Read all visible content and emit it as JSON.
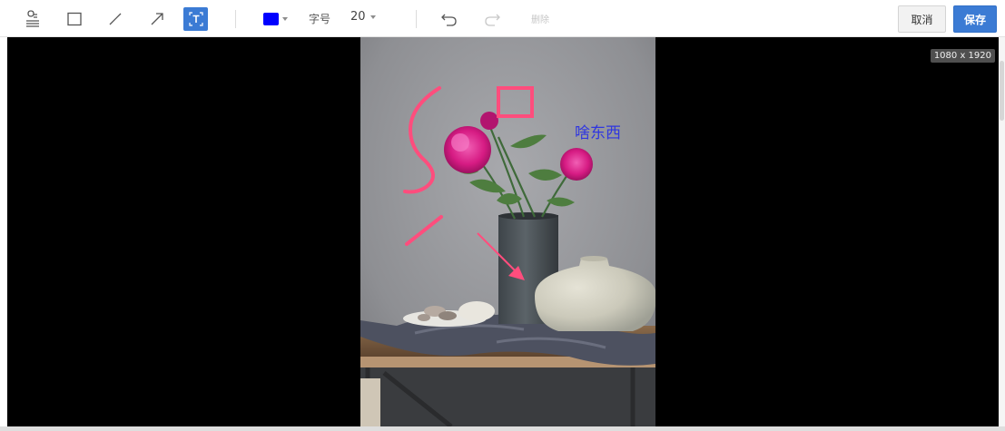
{
  "toolbar": {
    "tools": [
      {
        "id": "mosaic",
        "icon": "brush-icon",
        "active": false
      },
      {
        "id": "rect",
        "icon": "rectangle-icon",
        "active": false
      },
      {
        "id": "line",
        "icon": "line-icon",
        "active": false
      },
      {
        "id": "arrow",
        "icon": "arrow-icon",
        "active": false
      },
      {
        "id": "text",
        "icon": "text-tool-icon",
        "active": true
      }
    ],
    "color": "#0000ff",
    "accent": "#3b7bd4",
    "font_size_label": "字号",
    "font_size_value": "20",
    "undo_icon": "undo-icon",
    "redo_icon": "redo-icon",
    "delete_label": "删除",
    "cancel_label": "取消",
    "save_label": "保存"
  },
  "canvas": {
    "dimensions_label": "1080 x 1920",
    "annotation_text": "啥东西",
    "annotation_color": "#2f36e0",
    "stroke_color": "#ff4d7d"
  }
}
